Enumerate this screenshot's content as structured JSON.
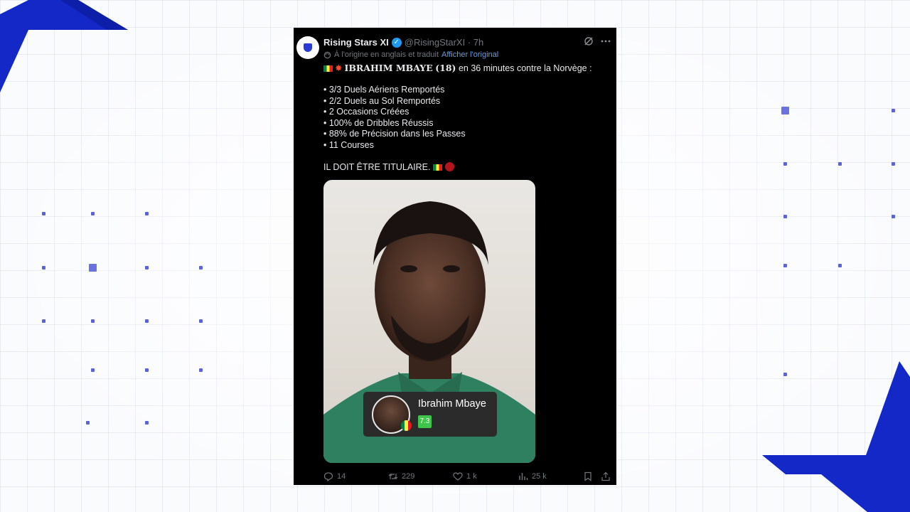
{
  "tweet": {
    "author_name": "Rising Stars XI",
    "handle": "@RisingStarXI",
    "time": "· 7h",
    "translation_note": "À l'origine en anglais et traduit",
    "translation_link": "Afficher l'original",
    "headline_name": "IBRAHIM MBAYE",
    "headline_age": "(18)",
    "headline_rest": " en 36 minutes contre la Norvège :",
    "stats": [
      "• 3/3 Duels Aériens Remportés",
      "• 2/2 Duels au Sol Remportés",
      "• 2 Occasions Créées",
      "• 100% de Dribbles Réussis",
      "• 88% de Précision dans les Passes",
      "• 11 Courses"
    ],
    "closing": "IL DOIT ÊTRE TITULAIRE.",
    "media_card": {
      "player_name": "Ibrahim Mbaye",
      "rating": "7.3"
    },
    "actions": {
      "replies": "14",
      "retweets": "229",
      "likes": "1 k",
      "views": "25 k"
    }
  },
  "colors": {
    "accent_blue": "#1d9bf0",
    "deco_blue": "#1428c8",
    "rating_green": "#3fc54a"
  },
  "icons": [
    "verified-badge-icon",
    "grok-icon",
    "more-icon",
    "translate-icon",
    "reply-icon",
    "retweet-icon",
    "like-icon",
    "views-icon",
    "bookmark-icon",
    "share-icon",
    "senegal-flag-icon",
    "fire-spark-icon"
  ]
}
